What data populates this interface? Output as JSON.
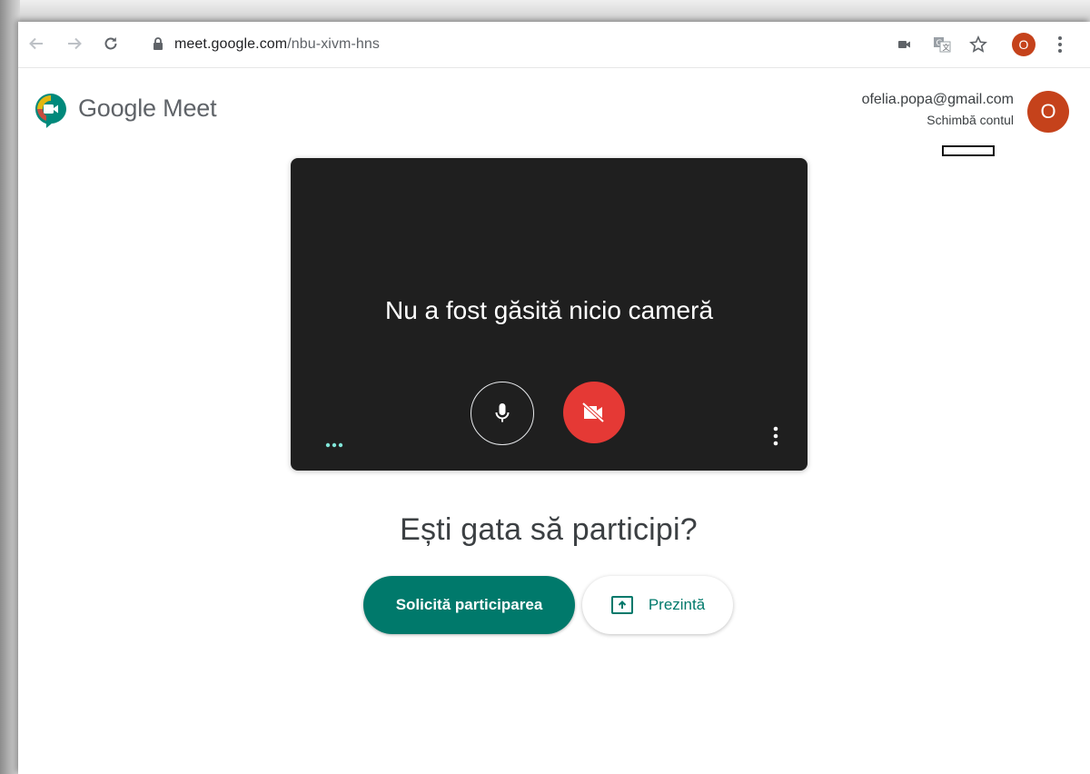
{
  "browser": {
    "url_host": "meet.google.com",
    "url_path": "/nbu-xivm-hns",
    "profile_initial": "O",
    "icons": [
      "back-icon",
      "forward-icon",
      "reload-icon",
      "lock-icon",
      "camera-blocked-icon",
      "translate-icon",
      "bookmark-star-icon",
      "more-vert-icon"
    ]
  },
  "header": {
    "brand": "Google Meet",
    "account_email": "ofelia.popa@gmail.com",
    "switch_account": "Schimbă contul",
    "avatar_initial": "O"
  },
  "preview": {
    "message": "Nu a fost găsită nicio cameră",
    "mic_state": "on",
    "camera_state": "off"
  },
  "join": {
    "prompt": "Ești gata să participi?",
    "join_label": "Solicită participarea",
    "present_label": "Prezintă"
  },
  "colors": {
    "accent": "#00796b",
    "camera_off": "#e53935",
    "avatar": "#c5421b",
    "preview_bg": "#1f1f1f"
  }
}
